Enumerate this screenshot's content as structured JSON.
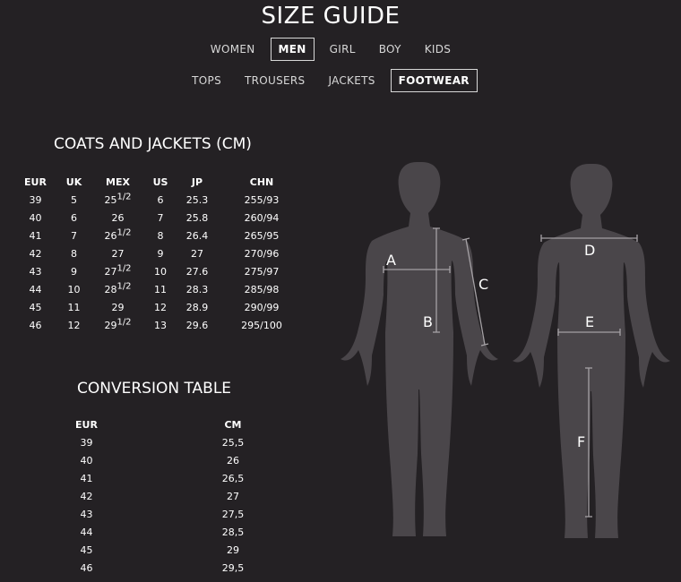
{
  "page": {
    "title": "SIZE GUIDE"
  },
  "nav": {
    "categories": [
      {
        "label": "WOMEN",
        "active": false
      },
      {
        "label": "MEN",
        "active": true
      },
      {
        "label": "GIRL",
        "active": false
      },
      {
        "label": "BOY",
        "active": false
      },
      {
        "label": "KIDS",
        "active": false
      }
    ],
    "subcategories": [
      {
        "label": "TOPS",
        "active": false
      },
      {
        "label": "TROUSERS",
        "active": false
      },
      {
        "label": "JACKETS",
        "active": false
      },
      {
        "label": "FOOTWEAR",
        "active": true
      }
    ]
  },
  "size_table": {
    "title": "COATS AND JACKETS (CM)",
    "columns": [
      "EUR",
      "UK",
      "MEX",
      "US",
      "JP",
      "CHN"
    ],
    "rows": [
      [
        "39",
        "5",
        "25",
        "6",
        "25.3",
        "255/93"
      ],
      [
        "40",
        "6",
        "26",
        "7",
        "25.8",
        "260/94"
      ],
      [
        "41",
        "7",
        "26",
        "8",
        "26.4",
        "265/95"
      ],
      [
        "42",
        "8",
        "27",
        "9",
        "27",
        "270/96"
      ],
      [
        "43",
        "9",
        "27",
        "10",
        "27.6",
        "275/97"
      ],
      [
        "44",
        "10",
        "28",
        "11",
        "28.3",
        "285/98"
      ],
      [
        "45",
        "11",
        "29",
        "12",
        "28.9",
        "290/99"
      ],
      [
        "46",
        "12",
        "29",
        "13",
        "29.6",
        "295/100"
      ]
    ],
    "mex_half_sup": [
      "1/2",
      "",
      "1/2",
      "",
      "1/2",
      "1/2",
      "",
      "1/2"
    ]
  },
  "conversion_table": {
    "title": "CONVERSION TABLE",
    "columns": [
      "EUR",
      "CM"
    ],
    "rows": [
      [
        "39",
        "25,5"
      ],
      [
        "40",
        "26"
      ],
      [
        "41",
        "26,5"
      ],
      [
        "42",
        "27"
      ],
      [
        "43",
        "27,5"
      ],
      [
        "44",
        "28,5"
      ],
      [
        "45",
        "29"
      ],
      [
        "46",
        "29,5"
      ]
    ]
  },
  "figure": {
    "labels": {
      "a": "A",
      "b": "B",
      "c": "C",
      "d": "D",
      "e": "E",
      "f": "F"
    },
    "silhouette_color": "#4a464a",
    "line_color": "#a5a1a5"
  }
}
